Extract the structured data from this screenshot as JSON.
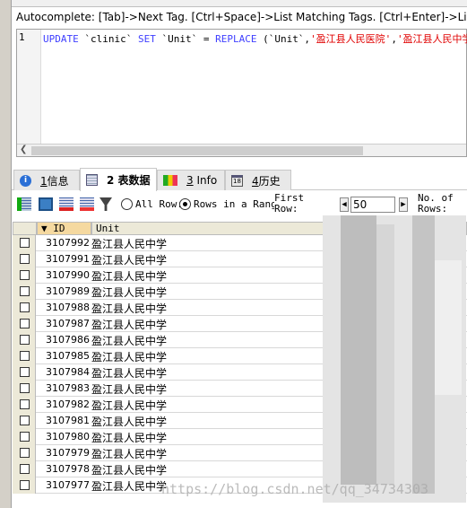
{
  "autocomplete_hint": "Autocomplete: [Tab]->Next Tag. [Ctrl+Space]->List Matching Tags. [Ctrl+Enter]->List A",
  "editor": {
    "line_number": "1",
    "sql": {
      "kw1": "UPDATE",
      "t1": " `clinic` ",
      "kw2": "SET",
      "t2": " `Unit` = ",
      "kw3": "REPLACE",
      "t3": " (`Unit`,",
      "s1": "'盈江县人民医院'",
      "t4": ",",
      "s2": "'盈江县人民中学'",
      "t5": ")"
    }
  },
  "tabs": [
    {
      "num": "1",
      "label": "信息",
      "icon": "info-icon"
    },
    {
      "num": "2",
      "label": "表数据",
      "icon": "table-icon",
      "active": true
    },
    {
      "num": "3",
      "label": "Info",
      "icon": "shapes-icon"
    },
    {
      "num": "4",
      "label": "历史",
      "icon": "calendar-icon"
    }
  ],
  "toolbar": {
    "all_rows": "All Row:",
    "rows_in_range": "Rows in a Rang",
    "first_row": "First\nRow:",
    "first_row_value": "50",
    "no_of_rows": "No. of\nRows:",
    "selected": "rows_in_range"
  },
  "grid": {
    "columns": [
      "ID",
      "Unit"
    ],
    "rows": [
      [
        "3107992",
        "盈江县人民中学"
      ],
      [
        "3107991",
        "盈江县人民中学"
      ],
      [
        "3107990",
        "盈江县人民中学"
      ],
      [
        "3107989",
        "盈江县人民中学"
      ],
      [
        "3107988",
        "盈江县人民中学"
      ],
      [
        "3107987",
        "盈江县人民中学"
      ],
      [
        "3107986",
        "盈江县人民中学"
      ],
      [
        "3107985",
        "盈江县人民中学"
      ],
      [
        "3107984",
        "盈江县人民中学"
      ],
      [
        "3107983",
        "盈江县人民中学"
      ],
      [
        "3107982",
        "盈江县人民中学"
      ],
      [
        "3107981",
        "盈江县人民中学"
      ],
      [
        "3107980",
        "盈江县人民中学"
      ],
      [
        "3107979",
        "盈江县人民中学"
      ],
      [
        "3107978",
        "盈江县人民中学"
      ],
      [
        "3107977",
        "盈江县人民中学"
      ]
    ]
  },
  "watermark": "https://blog.csdn.net/qq_34734303"
}
